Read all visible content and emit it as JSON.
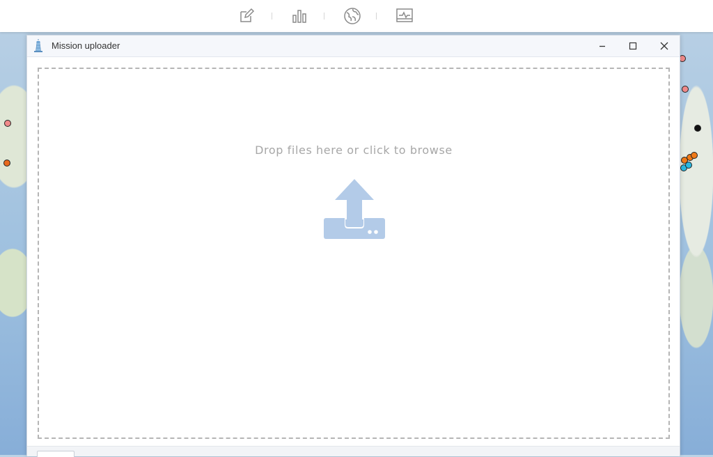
{
  "toolbar": {
    "icons": [
      "edit-icon",
      "bar-chart-icon",
      "globe-icon",
      "monitor-chart-icon"
    ]
  },
  "dialog": {
    "title": "Mission uploader",
    "icon": "lighthouse-icon",
    "controls": {
      "minimize": "−",
      "maximize": "□",
      "close": "✕"
    },
    "dropzone": {
      "text": "Drop files here or click to browse",
      "icon": "upload-icon"
    }
  },
  "colors": {
    "upload_icon": "#b3cbe8",
    "drop_text": "#a7a7a7",
    "dash_border": "#b5b5b5"
  }
}
